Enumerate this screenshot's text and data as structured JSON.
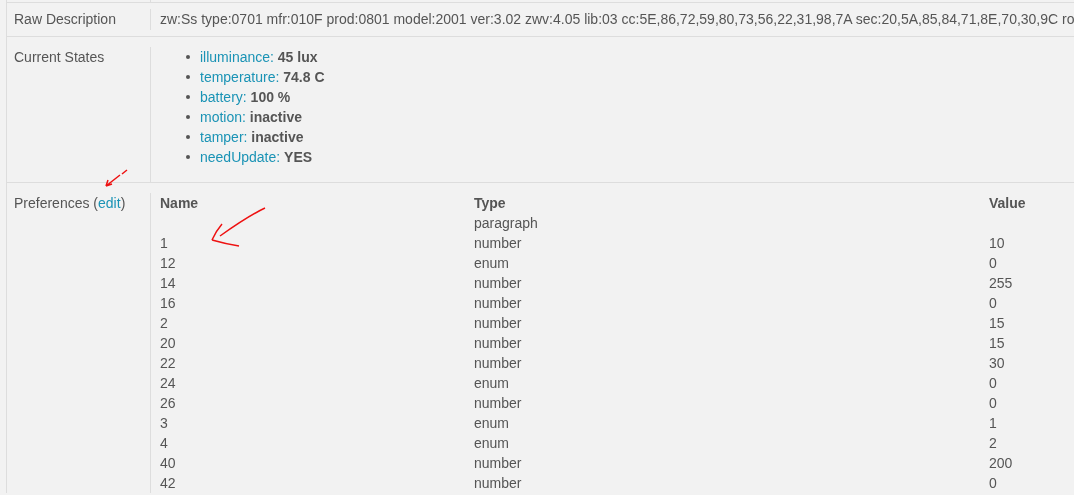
{
  "rows": [
    {
      "kind": "text",
      "label": "Raw Description",
      "value": "zw:Ss type:0701 mfr:010F prod:0801 model:2001 ver:3.02 zwv:4.05 lib:03 cc:5E,86,72,59,80,73,56,22,31,98,7A sec:20,5A,85,84,71,8E,70,30,9C ro"
    },
    {
      "kind": "states",
      "label": "Current States",
      "states": [
        {
          "name": "illuminance:",
          "value": "45 lux"
        },
        {
          "name": "temperature:",
          "value": "74.8 C"
        },
        {
          "name": "battery:",
          "value": "100 %"
        },
        {
          "name": "motion:",
          "value": "inactive"
        },
        {
          "name": "tamper:",
          "value": "inactive"
        },
        {
          "name": "needUpdate:",
          "value": "YES"
        }
      ]
    },
    {
      "kind": "preferences",
      "label": "Preferences (",
      "link": "edit",
      "label_end": ")",
      "columns": [
        "Name",
        "Type",
        "Value"
      ],
      "prefs": [
        {
          "type": "paragraph"
        },
        {
          "name": "1",
          "type": "number",
          "value": "10"
        },
        {
          "name": "12",
          "type": "enum",
          "value": "0"
        },
        {
          "name": "14",
          "type": "number",
          "value": "255"
        },
        {
          "name": "16",
          "type": "number",
          "value": "0"
        },
        {
          "name": "2",
          "type": "number",
          "value": "15"
        },
        {
          "name": "20",
          "type": "number",
          "value": "15"
        },
        {
          "name": "22",
          "type": "number",
          "value": "30"
        },
        {
          "name": "24",
          "type": "enum",
          "value": "0"
        },
        {
          "name": "26",
          "type": "number",
          "value": "0"
        },
        {
          "name": "3",
          "type": "enum",
          "value": "1"
        },
        {
          "name": "4",
          "type": "enum",
          "value": "2"
        },
        {
          "name": "40",
          "type": "number",
          "value": "200"
        },
        {
          "name": "42",
          "type": "number",
          "value": "0"
        }
      ]
    }
  ]
}
